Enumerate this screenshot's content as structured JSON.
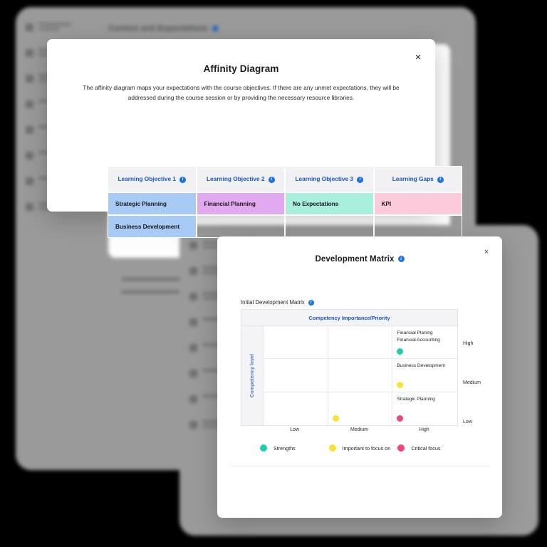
{
  "background": {
    "app_title": "Context and Expectations",
    "sidebar_items": [
      {
        "label": "My Courses Discussions",
        "icon": "courses-icon"
      },
      {
        "label": "My Profile",
        "icon": "profile-icon"
      },
      {
        "label": "My Achievements",
        "icon": "chart-icon"
      },
      {
        "label": "Resources",
        "icon": "resources-icon"
      },
      {
        "label": "Analytics",
        "icon": "analytics-icon"
      },
      {
        "label": "Marketplace",
        "icon": "marketplace-icon"
      },
      {
        "label": "Reports",
        "icon": "reports-icon"
      },
      {
        "label": "Learning Paths",
        "icon": "learning-icon"
      }
    ]
  },
  "affinity": {
    "close_label": "×",
    "title": "Affinity Diagram",
    "description": "The affinity diagram maps your expectations with the course objectives. If there are any unmet expectations, they will be addressed during the course session or by providing the necessary resource libraries.",
    "info_glyph": "i",
    "columns": [
      {
        "label": "Learning Objective 1",
        "color": "#a8cbf5"
      },
      {
        "label": "Learning Objective 2",
        "color": "#e0a9f0"
      },
      {
        "label": "Learning Objective 3",
        "color": "#a8efdd"
      },
      {
        "label": "Learning Gaps",
        "color": "#fbcadb"
      }
    ],
    "rows": [
      [
        "Strategic Planning",
        "Financial Planning",
        "No Expectations",
        "KPI"
      ],
      [
        "Business Development",
        "",
        "",
        ""
      ]
    ]
  },
  "development": {
    "close_label": "×",
    "title": "Development Matrix",
    "subtitle": "Initial Development Matrix",
    "info_glyph": "i",
    "x_axis_title": "Competency Importance/Priority",
    "y_axis_title": "Competency level",
    "column_labels": [
      "Low",
      "Medium",
      "High"
    ],
    "row_labels": [
      "High",
      "Medium",
      "Low"
    ],
    "legend": [
      {
        "label": "Strengths",
        "color": "#1ecfae"
      },
      {
        "label": "Important to focus on",
        "color": "#f7e335"
      },
      {
        "label": "Critical focus",
        "color": "#f2447f"
      }
    ],
    "cells": [
      {
        "row": 0,
        "col": 0,
        "labels": [],
        "dot": null
      },
      {
        "row": 0,
        "col": 1,
        "labels": [],
        "dot": null
      },
      {
        "row": 0,
        "col": 2,
        "labels": [
          "Financial Planing",
          "Financial Accounting"
        ],
        "dot": "#1ecfae"
      },
      {
        "row": 1,
        "col": 0,
        "labels": [],
        "dot": null
      },
      {
        "row": 1,
        "col": 1,
        "labels": [],
        "dot": null
      },
      {
        "row": 1,
        "col": 2,
        "labels": [
          "Business Development"
        ],
        "dot": "#f7e335"
      },
      {
        "row": 2,
        "col": 0,
        "labels": [],
        "dot": null
      },
      {
        "row": 2,
        "col": 1,
        "labels": [],
        "dot": "#f7e335"
      },
      {
        "row": 2,
        "col": 2,
        "labels": [
          "Strategic Planning"
        ],
        "dot": "#f2447f"
      }
    ]
  }
}
